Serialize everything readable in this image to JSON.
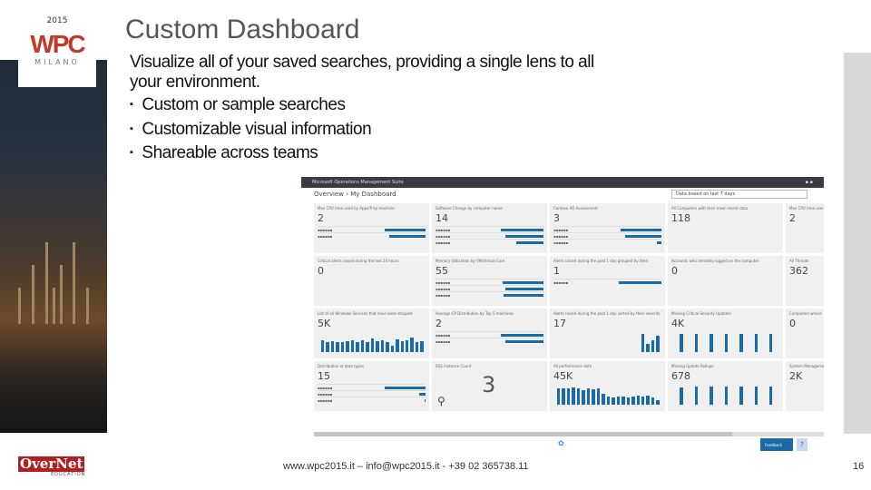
{
  "slide": {
    "title": "Custom Dashboard",
    "intro": "Visualize all of your saved searches, providing a single lens to all your environment.",
    "bullets": [
      "Custom or sample searches",
      "Customizable visual information",
      "Shareable across teams"
    ],
    "footer": "www.wpc2015.it – info@wpc2015.it - +39 02 365738.11",
    "page": "16"
  },
  "logos": {
    "wpc_year": "2015",
    "wpc": "WPC",
    "wpc_city": "MILANO",
    "overnet": "OverNet",
    "overnet_sub": "EDUCATION"
  },
  "app": {
    "title": "Microsoft Operations Management Suite",
    "breadcrumb": "Overview  ›  My Dashboard",
    "range": "Data based on last 7 days",
    "feedback": "Feedback",
    "help": "?",
    "tiles": [
      {
        "t": "Max CPU time used by Apps/P by machine",
        "v": "2",
        "rows": [
          90,
          80
        ]
      },
      {
        "t": "Software Change by computer name",
        "v": "14",
        "rows": [
          95,
          85,
          60
        ]
      },
      {
        "t": "Contoso AD Assessment",
        "v": "3",
        "rows": [
          90,
          80,
          10
        ]
      },
      {
        "t": "All Computers with their most recent data",
        "v": "118",
        "rows": []
      },
      {
        "t": "Max CPU time used",
        "v": "2",
        "rows": []
      },
      {
        "t": "Critical alerts raised during the last 24 hours",
        "v": "0",
        "rows": []
      },
      {
        "t": "Memory Utilization by VM/Virtual Core",
        "v": "55",
        "rows": [
          90,
          85,
          88
        ]
      },
      {
        "t": "Alerts raised during the past 1 day grouped by their",
        "v": "1",
        "rows": [
          95
        ]
      },
      {
        "t": "Accounts who remotely logged on the computer",
        "v": "0",
        "rows": []
      },
      {
        "t": "All Threats",
        "v": "362",
        "rows": []
      },
      {
        "t": "List of all Windows Services that have been stopped",
        "v": "5K",
        "bars": [
          60,
          50,
          55,
          50,
          52,
          55,
          58,
          52,
          60,
          50,
          70,
          55,
          60,
          50,
          30,
          62,
          55,
          60,
          75,
          50,
          55
        ]
      },
      {
        "t": "Average CP Distribution by Top 5 machines",
        "v": "2",
        "rows": [
          95,
          85
        ]
      },
      {
        "t": "Alerts raised during the past 1 day sorted by their severity",
        "v": "17",
        "bars": [
          0,
          0,
          0,
          0,
          0,
          0,
          0,
          0,
          0,
          0,
          0,
          0,
          0,
          0,
          0,
          0,
          0,
          90,
          40,
          60,
          80
        ]
      },
      {
        "t": "Missing Critical Security Updates",
        "v": "4K",
        "bars": [
          0,
          90,
          0,
          0,
          90,
          0,
          0,
          90,
          0,
          0,
          90,
          0,
          0,
          90,
          0,
          0,
          90,
          0,
          0,
          90,
          0
        ]
      },
      {
        "t": "Computers where",
        "v": "0",
        "rows": []
      },
      {
        "t": "Distribution of data types",
        "v": "15",
        "rows": [
          90,
          15,
          2
        ]
      },
      {
        "t": "SQL Instance Count",
        "v": "3",
        "big": true
      },
      {
        "t": "All performance data",
        "v": "45K",
        "bars": [
          80,
          82,
          80,
          85,
          80,
          75,
          80,
          78,
          82,
          55,
          40,
          35,
          40,
          40,
          35,
          42,
          45,
          42,
          45,
          35,
          25
        ]
      },
      {
        "t": "Missing Update Rollups",
        "v": "678",
        "bars": [
          0,
          85,
          0,
          0,
          90,
          0,
          0,
          90,
          0,
          0,
          90,
          0,
          0,
          90,
          0,
          0,
          90,
          0,
          0,
          90,
          0
        ]
      },
      {
        "t": "System Management",
        "v": "2K",
        "rows": []
      }
    ]
  },
  "colors": {
    "accent": "#1a6aa8",
    "wpc_red": "#c0392b",
    "overnet_red": "#b02020"
  }
}
